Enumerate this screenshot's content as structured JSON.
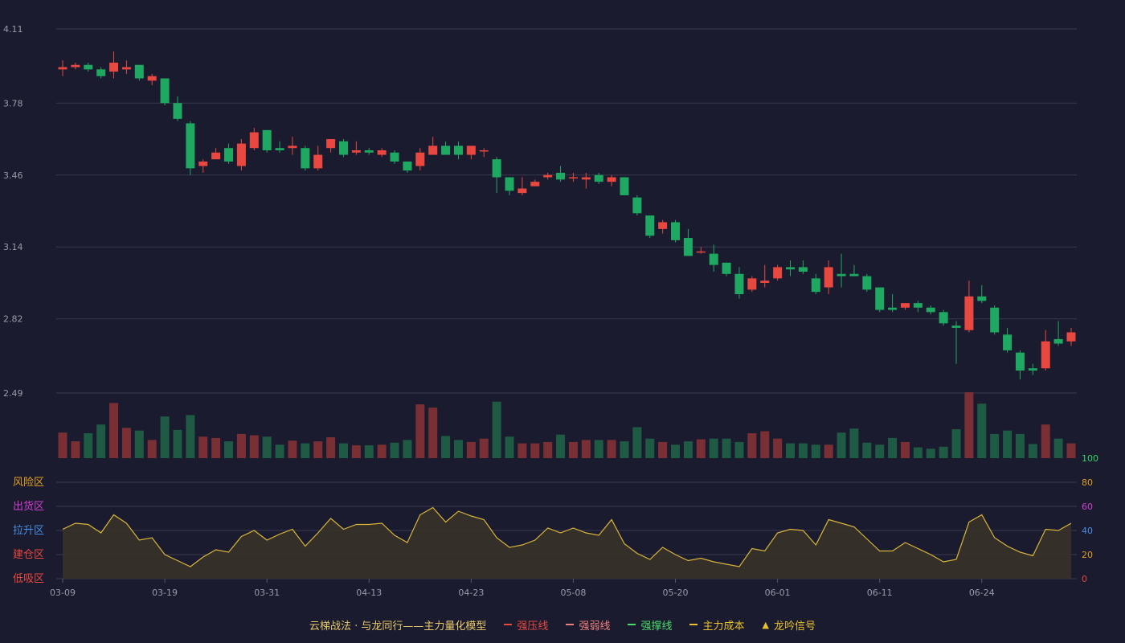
{
  "chart_data": {
    "type": "candlestick",
    "price_axis": {
      "ticks": [
        "4.11",
        "3.78",
        "3.46",
        "3.14",
        "2.82",
        "2.49"
      ],
      "ylim": [
        2.49,
        4.11
      ]
    },
    "x_tick_labels": [
      "03-09",
      "03-19",
      "03-31",
      "04-13",
      "04-23",
      "05-08",
      "05-20",
      "06-01",
      "06-11",
      "06-24"
    ],
    "x_tick_index": [
      0,
      8,
      16,
      24,
      32,
      40,
      48,
      56,
      64,
      72
    ],
    "colors": {
      "up": "#e8483f",
      "down": "#1fa862",
      "vol_up": "#7a2f35",
      "vol_down": "#1e5a44",
      "line": "#d9b53a",
      "fill": "#3a3428"
    },
    "candles": [
      [
        3.93,
        3.94,
        3.9,
        3.97
      ],
      [
        3.94,
        3.95,
        3.93,
        3.96
      ],
      [
        3.95,
        3.93,
        3.92,
        3.96
      ],
      [
        3.93,
        3.9,
        3.89,
        3.94
      ],
      [
        3.92,
        3.96,
        3.89,
        4.01
      ],
      [
        3.93,
        3.94,
        3.91,
        3.97
      ],
      [
        3.95,
        3.89,
        3.88,
        3.95
      ],
      [
        3.88,
        3.9,
        3.86,
        3.91
      ],
      [
        3.89,
        3.78,
        3.77,
        3.89
      ],
      [
        3.78,
        3.71,
        3.7,
        3.81
      ],
      [
        3.69,
        3.49,
        3.46,
        3.7
      ],
      [
        3.5,
        3.52,
        3.47,
        3.53
      ],
      [
        3.53,
        3.56,
        3.53,
        3.58
      ],
      [
        3.58,
        3.52,
        3.51,
        3.6
      ],
      [
        3.5,
        3.6,
        3.48,
        3.62
      ],
      [
        3.58,
        3.65,
        3.57,
        3.67
      ],
      [
        3.66,
        3.57,
        3.56,
        3.66
      ],
      [
        3.58,
        3.57,
        3.56,
        3.61
      ],
      [
        3.58,
        3.59,
        3.55,
        3.63
      ],
      [
        3.58,
        3.49,
        3.48,
        3.59
      ],
      [
        3.49,
        3.55,
        3.48,
        3.59
      ],
      [
        3.58,
        3.62,
        3.56,
        3.62
      ],
      [
        3.61,
        3.55,
        3.54,
        3.62
      ],
      [
        3.56,
        3.57,
        3.55,
        3.61
      ],
      [
        3.57,
        3.56,
        3.55,
        3.58
      ],
      [
        3.55,
        3.57,
        3.54,
        3.58
      ],
      [
        3.56,
        3.52,
        3.51,
        3.57
      ],
      [
        3.52,
        3.48,
        3.47,
        3.52
      ],
      [
        3.5,
        3.56,
        3.48,
        3.58
      ],
      [
        3.55,
        3.59,
        3.55,
        3.63
      ],
      [
        3.59,
        3.55,
        3.55,
        3.61
      ],
      [
        3.59,
        3.55,
        3.53,
        3.61
      ],
      [
        3.55,
        3.59,
        3.53,
        3.59
      ],
      [
        3.57,
        3.57,
        3.54,
        3.58
      ],
      [
        3.53,
        3.45,
        3.38,
        3.54
      ],
      [
        3.45,
        3.39,
        3.37,
        3.45
      ],
      [
        3.38,
        3.4,
        3.37,
        3.45
      ],
      [
        3.41,
        3.43,
        3.41,
        3.44
      ],
      [
        3.45,
        3.46,
        3.44,
        3.47
      ],
      [
        3.47,
        3.44,
        3.43,
        3.5
      ],
      [
        3.45,
        3.45,
        3.43,
        3.47
      ],
      [
        3.44,
        3.45,
        3.4,
        3.47
      ],
      [
        3.46,
        3.43,
        3.42,
        3.47
      ],
      [
        3.43,
        3.45,
        3.41,
        3.46
      ],
      [
        3.45,
        3.37,
        3.37,
        3.45
      ],
      [
        3.36,
        3.29,
        3.28,
        3.37
      ],
      [
        3.28,
        3.19,
        3.18,
        3.28
      ],
      [
        3.22,
        3.25,
        3.2,
        3.26
      ],
      [
        3.25,
        3.17,
        3.16,
        3.26
      ],
      [
        3.18,
        3.1,
        3.1,
        3.22
      ],
      [
        3.12,
        3.12,
        3.11,
        3.14
      ],
      [
        3.11,
        3.06,
        3.03,
        3.15
      ],
      [
        3.07,
        3.02,
        3.01,
        3.07
      ],
      [
        3.02,
        2.93,
        2.91,
        3.05
      ],
      [
        2.95,
        3.0,
        2.94,
        3.01
      ],
      [
        2.98,
        2.99,
        2.96,
        3.06
      ],
      [
        3.0,
        3.05,
        2.99,
        3.06
      ],
      [
        3.05,
        3.04,
        3.01,
        3.08
      ],
      [
        3.05,
        3.03,
        3.02,
        3.08
      ],
      [
        3.0,
        2.94,
        2.93,
        3.02
      ],
      [
        2.96,
        3.05,
        2.93,
        3.08
      ],
      [
        3.02,
        3.01,
        2.96,
        3.11
      ],
      [
        3.02,
        3.01,
        3.01,
        3.06
      ],
      [
        3.01,
        2.95,
        2.94,
        3.02
      ],
      [
        2.96,
        2.86,
        2.85,
        2.96
      ],
      [
        2.87,
        2.86,
        2.85,
        2.93
      ],
      [
        2.87,
        2.89,
        2.86,
        2.89
      ],
      [
        2.89,
        2.87,
        2.85,
        2.9
      ],
      [
        2.87,
        2.85,
        2.84,
        2.88
      ],
      [
        2.85,
        2.8,
        2.79,
        2.86
      ],
      [
        2.79,
        2.78,
        2.62,
        2.81
      ],
      [
        2.77,
        2.92,
        2.76,
        2.99
      ],
      [
        2.92,
        2.9,
        2.89,
        2.97
      ],
      [
        2.87,
        2.76,
        2.75,
        2.88
      ],
      [
        2.75,
        2.68,
        2.67,
        2.78
      ],
      [
        2.67,
        2.59,
        2.55,
        2.68
      ],
      [
        2.6,
        2.59,
        2.57,
        2.62
      ],
      [
        2.6,
        2.72,
        2.59,
        2.77
      ],
      [
        2.73,
        2.71,
        2.7,
        2.81
      ],
      [
        2.72,
        2.76,
        2.7,
        2.78
      ]
    ],
    "volume": [
      38,
      25,
      37,
      50,
      82,
      45,
      41,
      27,
      62,
      42,
      64,
      32,
      30,
      25,
      36,
      34,
      32,
      20,
      26,
      22,
      25,
      31,
      22,
      19,
      19,
      20,
      23,
      27,
      80,
      75,
      33,
      27,
      24,
      29,
      84,
      32,
      22,
      22,
      24,
      35,
      24,
      27,
      27,
      27,
      25,
      46,
      29,
      24,
      20,
      25,
      28,
      29,
      29,
      24,
      37,
      40,
      29,
      22,
      22,
      20,
      20,
      38,
      44,
      23,
      20,
      30,
      24,
      16,
      14,
      17,
      43,
      98,
      81,
      36,
      41,
      36,
      21,
      50,
      29,
      22
    ],
    "indicator_axis": {
      "ylim": [
        0,
        100
      ],
      "ticks": [
        "100",
        "80",
        "60",
        "40",
        "20",
        "0"
      ],
      "tick_colors": [
        "#32d66a",
        "#e0a020",
        "#d040d0",
        "#4a90e2",
        "#e0a020",
        "#e8483f"
      ]
    },
    "zones": [
      {
        "label": "风险区",
        "color": "#e0a020"
      },
      {
        "label": "出货区",
        "color": "#d040d0"
      },
      {
        "label": "拉升区",
        "color": "#4a90e2"
      },
      {
        "label": "建仓区",
        "color": "#e8483f"
      },
      {
        "label": "低吸区",
        "color": "#e8483f"
      }
    ],
    "indicator_line": [
      41,
      46,
      45,
      38,
      53,
      46,
      32,
      34,
      20,
      15,
      10,
      18,
      24,
      22,
      35,
      40,
      32,
      37,
      41,
      27,
      38,
      50,
      41,
      45,
      45,
      46,
      36,
      30,
      53,
      59,
      47,
      56,
      52,
      49,
      34,
      26,
      28,
      32,
      42,
      38,
      42,
      38,
      36,
      49,
      29,
      21,
      16,
      26,
      20,
      15,
      17,
      14,
      12,
      10,
      25,
      23,
      38,
      41,
      40,
      28,
      49,
      46,
      43,
      33,
      23,
      23,
      30,
      25,
      20,
      14,
      16,
      47,
      53,
      34,
      27,
      22,
      19,
      41,
      40,
      46
    ]
  },
  "legend": {
    "title": "云梯战法 · 与龙同行——主力量化模型",
    "items": [
      {
        "label": "强压线",
        "color": "#e8483f",
        "style": "solid"
      },
      {
        "label": "强弱线",
        "color": "#f08080",
        "style": "dashed"
      },
      {
        "label": "强撑线",
        "color": "#4adc6a",
        "style": "solid"
      },
      {
        "label": "主力成本",
        "color": "#e8c030",
        "style": "dashed"
      },
      {
        "label": "龙吟信号",
        "color": "#e8c030",
        "style": "triangle"
      }
    ]
  }
}
